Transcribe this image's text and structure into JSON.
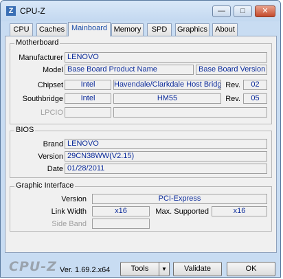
{
  "window": {
    "title": "CPU-Z",
    "icon_letter": "Z",
    "minimize": "—",
    "maximize": "□",
    "close": "✕"
  },
  "tabs": [
    "CPU",
    "Caches",
    "Mainboard",
    "Memory",
    "SPD",
    "Graphics",
    "About"
  ],
  "active_tab": "Mainboard",
  "motherboard": {
    "legend": "Motherboard",
    "manufacturer_label": "Manufacturer",
    "manufacturer": "LENOVO",
    "model_label": "Model",
    "model": "Base Board Product Name",
    "model_version": "Base Board Version",
    "chipset_label": "Chipset",
    "chipset_vendor": "Intel",
    "chipset_name": "Havendale/Clarkdale Host Bridge",
    "chipset_rev_label": "Rev.",
    "chipset_rev": "02",
    "southbridge_label": "Southbridge",
    "southbridge_vendor": "Intel",
    "southbridge_name": "HM55",
    "southbridge_rev_label": "Rev.",
    "southbridge_rev": "05",
    "lpcio_label": "LPCIO",
    "lpcio_vendor": "",
    "lpcio_name": ""
  },
  "bios": {
    "legend": "BIOS",
    "brand_label": "Brand",
    "brand": "LENOVO",
    "version_label": "Version",
    "version": "29CN38WW(V2.15)",
    "date_label": "Date",
    "date": "01/28/2011"
  },
  "graphic_interface": {
    "legend": "Graphic Interface",
    "version_label": "Version",
    "version": "PCI-Express",
    "link_width_label": "Link Width",
    "link_width": "x16",
    "max_supported_label": "Max. Supported",
    "max_supported": "x16",
    "side_band_label": "Side Band",
    "side_band": ""
  },
  "footer": {
    "logo": "CPU-Z",
    "version": "Ver. 1.69.2.x64",
    "tools_label": "Tools",
    "tools_arrow": "▼",
    "validate_label": "Validate",
    "ok_label": "OK"
  }
}
